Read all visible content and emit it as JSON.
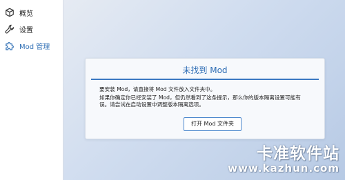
{
  "sidebar": {
    "items": [
      {
        "label": "概览",
        "icon": "cube-icon",
        "active": false
      },
      {
        "label": "设置",
        "icon": "wrench-icon",
        "active": false
      },
      {
        "label": "Mod 管理",
        "icon": "puzzle-icon",
        "active": true
      }
    ]
  },
  "card": {
    "title": "未找到 Mod",
    "lines": [
      "要安装 Mod，请直接将 Mod 文件放入文件夹中。",
      "如果你确定你已经安装了 Mod，但仍然看到了这条提示，那么你的版本隔离设置可能有",
      "误。请尝试在启动设置中调整版本隔离选项。"
    ],
    "button_label": "打开 Mod 文件夹"
  },
  "watermark": {
    "title": "卡准软件站",
    "url": "www.kazhun.com"
  },
  "colors": {
    "accent": "#2d6cb4",
    "active_nav": "#2f6fb5"
  }
}
